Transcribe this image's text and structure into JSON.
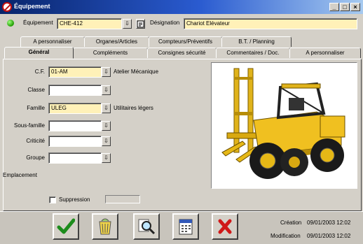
{
  "window": {
    "title": "Équipement",
    "controls": [
      "_",
      "□",
      "×"
    ]
  },
  "header": {
    "equipment_label": "Équipement",
    "equipment_value": "CHE-412",
    "designation_label": "Désignation",
    "designation_value": "Chariot Elévateur"
  },
  "tabs_back": [
    "A personnaliser",
    "Organes/Articles",
    "Compteurs/Préventifs",
    "B.T. / Planning"
  ],
  "tabs_front": [
    "Général",
    "Compléments",
    "Consignes sécurité",
    "Commentaires / Doc.",
    "A personnaliser"
  ],
  "active_tab": "Général",
  "form": {
    "cf": {
      "label": "C.F.",
      "value": "01-AM",
      "desc": "Atelier Mécanique"
    },
    "classe": {
      "label": "Classe",
      "value": "",
      "desc": ""
    },
    "famille": {
      "label": "Famille",
      "value": "ULEG",
      "desc": "Utilitaires légers"
    },
    "sous_famille": {
      "label": "Sous-famille",
      "value": "",
      "desc": ""
    },
    "criticite": {
      "label": "Criticité",
      "value": "",
      "desc": ""
    },
    "groupe": {
      "label": "Groupe",
      "value": "",
      "desc": ""
    },
    "emplacement": {
      "label": "Emplacement"
    },
    "suppression": {
      "label": "Suppression",
      "checked": false,
      "value": ""
    }
  },
  "toolbar": [
    "validate-icon",
    "trash-icon",
    "search-icon",
    "calendar-icon",
    "cancel-icon"
  ],
  "meta": {
    "creation_label": "Création",
    "creation_date": "09/01/2003 12:02",
    "modification_label": "Modification",
    "modification_date": "09/01/2003 12:02"
  },
  "colors": {
    "required_field": "#fff1b8",
    "title_start": "#08246b",
    "title_end": "#a6caf0"
  }
}
